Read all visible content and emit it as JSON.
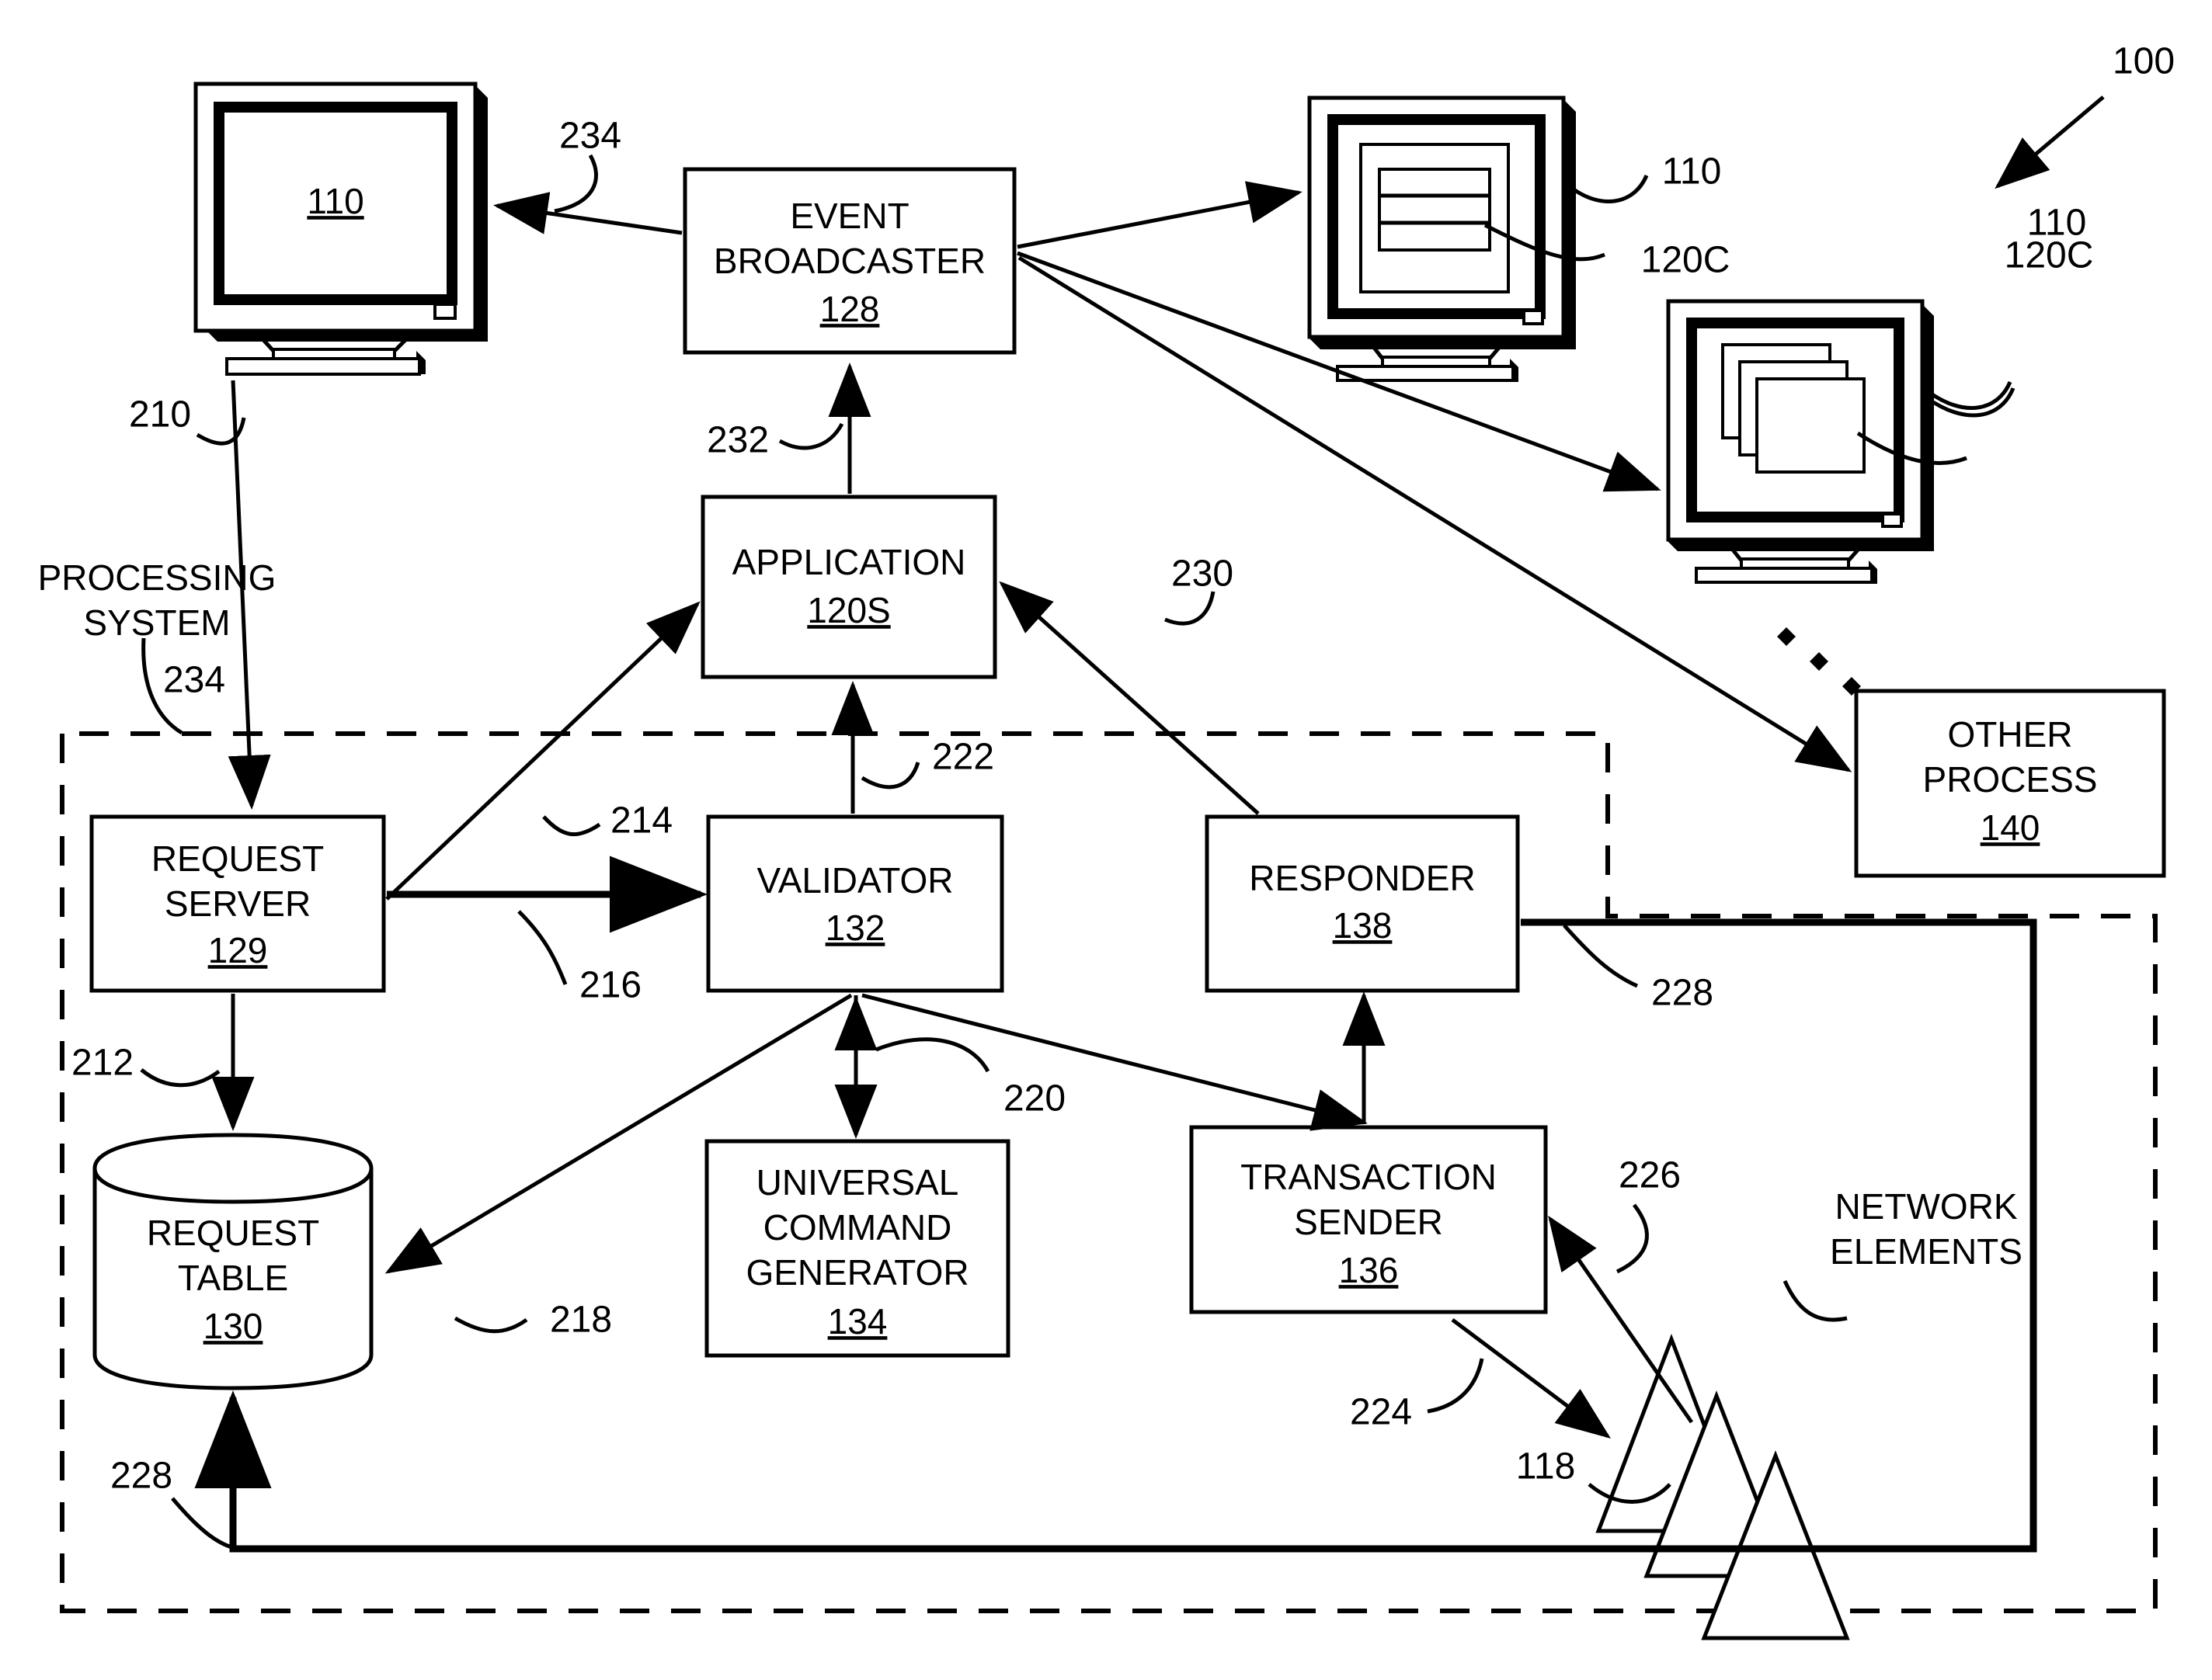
{
  "figure": {
    "system_ref": "100",
    "boundary_label_1": "PROCESSING",
    "boundary_label_2": "SYSTEM",
    "boundary_ref": "234"
  },
  "blocks": [
    {
      "id": "event_broadcaster",
      "line1": "EVENT",
      "line2": "BROADCASTER",
      "num": "128"
    },
    {
      "id": "application",
      "line1": "APPLICATION",
      "num": "120S"
    },
    {
      "id": "request_server",
      "line1": "REQUEST",
      "line2": "SERVER",
      "num": "129"
    },
    {
      "id": "validator",
      "line1": "VALIDATOR",
      "num": "132"
    },
    {
      "id": "responder",
      "line1": "RESPONDER",
      "num": "138"
    },
    {
      "id": "universal_command_generator",
      "line1": "UNIVERSAL",
      "line2": "COMMAND",
      "line3": "GENERATOR",
      "num": "134"
    },
    {
      "id": "transaction_sender",
      "line1": "TRANSACTION",
      "line2": "SENDER",
      "num": "136"
    },
    {
      "id": "other_process",
      "line1": "OTHER",
      "line2": "PROCESS",
      "num": "140"
    },
    {
      "id": "request_table",
      "line1": "REQUEST",
      "line2": "TABLE",
      "num": "130"
    }
  ],
  "monitors": [
    {
      "id": "monitor-left",
      "screen_label": "110"
    },
    {
      "id": "monitor-top-right",
      "callout_monitor": "110",
      "callout_window": "120C"
    },
    {
      "id": "monitor-lower-right",
      "callout_monitor": "110",
      "callout_window": "120C"
    }
  ],
  "network_elements": {
    "label_line1": "NETWORK",
    "label_line2": "ELEMENTS",
    "ref": "118"
  },
  "flow_refs": {
    "r210": "210",
    "r212": "212",
    "r214": "214",
    "r216": "216",
    "r218": "218",
    "r220": "220",
    "r222": "222",
    "r224": "224",
    "r226": "226",
    "r228_top": "228",
    "r228_bottom": "228",
    "r230": "230",
    "r232": "232",
    "r234": "234"
  }
}
